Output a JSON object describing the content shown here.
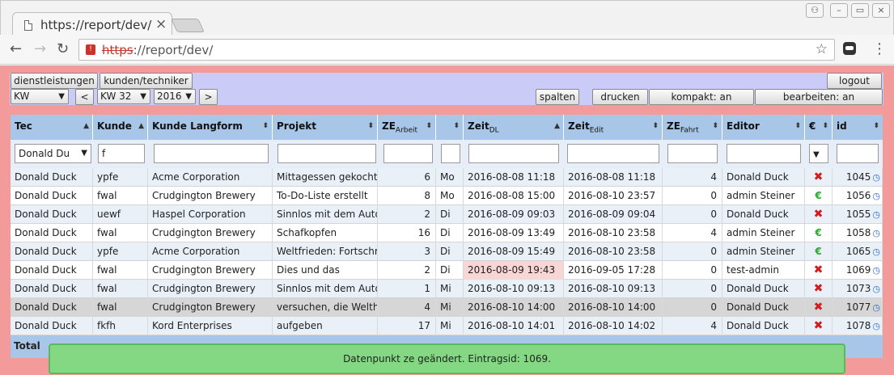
{
  "browser": {
    "tab_title": "https://report/dev/",
    "url_scheme": "https",
    "url_rest": "://report/dev/"
  },
  "controls": {
    "dienstleistungen": "dienstleistungen",
    "kunden_techniker": "kunden/techniker",
    "logout": "logout",
    "period_select": "KW",
    "prev": "<",
    "week_select": "KW 32",
    "year_select": "2016",
    "next": ">",
    "spalten": "spalten",
    "drucken": "drucken",
    "kompakt": "kompakt: an",
    "bearbeiten": "bearbeiten: an"
  },
  "columns": {
    "tec": "Tec",
    "kunde": "Kunde",
    "kunde_langform": "Kunde Langform",
    "projekt": "Projekt",
    "ze": "ZE",
    "ze_sub": "Arbeit",
    "zeit": "Zeit",
    "zeit_sub": "DL",
    "zeit_edit": "Zeit",
    "zeit_edit_sub": "Edit",
    "ze_fahrt": "ZE",
    "ze_fahrt_sub": "Fahrt",
    "editor": "Editor",
    "euro": "€",
    "id": "id"
  },
  "filters": {
    "tec": "Donald Du",
    "kunde": "f"
  },
  "rows": [
    {
      "tec": "Donald Duck",
      "kunde": "ypfe",
      "langform": "Acme Corporation",
      "projekt": "Mittagessen gekocht",
      "ze": "6",
      "tag": "Mo",
      "zeit": "2016-08-08 11:18",
      "edit": "2016-08-08 11:18",
      "fahrt": "4",
      "editor": "Donald Duck",
      "status": "✖",
      "id": "1045"
    },
    {
      "tec": "Donald Duck",
      "kunde": "fwal",
      "langform": "Crudgington Brewery",
      "projekt": "To-Do-Liste erstellt",
      "ze": "8",
      "tag": "Mo",
      "zeit": "2016-08-08 15:00",
      "edit": "2016-08-10 23:57",
      "fahrt": "0",
      "editor": "admin Steiner",
      "status": "€",
      "id": "1056"
    },
    {
      "tec": "Donald Duck",
      "kunde": "uewf",
      "langform": "Haspel Corporation",
      "projekt": "Sinnlos mit dem Auto g",
      "ze": "2",
      "tag": "Di",
      "zeit": "2016-08-09 09:03",
      "edit": "2016-08-09 09:04",
      "fahrt": "0",
      "editor": "Donald Duck",
      "status": "✖",
      "id": "1055"
    },
    {
      "tec": "Donald Duck",
      "kunde": "fwal",
      "langform": "Crudgington Brewery",
      "projekt": "Schafkopfen",
      "ze": "16",
      "tag": "Di",
      "zeit": "2016-08-09 13:49",
      "edit": "2016-08-10 23:58",
      "fahrt": "4",
      "editor": "admin Steiner",
      "status": "€",
      "id": "1058"
    },
    {
      "tec": "Donald Duck",
      "kunde": "ypfe",
      "langform": "Acme Corporation",
      "projekt": "Weltfrieden: Fortschritt",
      "ze": "3",
      "tag": "Di",
      "zeit": "2016-08-09 15:49",
      "edit": "2016-08-10 23:58",
      "fahrt": "0",
      "editor": "admin Steiner",
      "status": "€",
      "id": "1065"
    },
    {
      "tec": "Donald Duck",
      "kunde": "fwal",
      "langform": "Crudgington Brewery",
      "projekt": "Dies und das",
      "ze": "2",
      "tag": "Di",
      "zeit": "2016-08-09 19:43",
      "edit": "2016-09-05 17:28",
      "fahrt": "0",
      "editor": "test-admin",
      "status": "✖",
      "id": "1069"
    },
    {
      "tec": "Donald Duck",
      "kunde": "fwal",
      "langform": "Crudgington Brewery",
      "projekt": "Sinnlos mit dem Auto g",
      "ze": "1",
      "tag": "Mi",
      "zeit": "2016-08-10 09:13",
      "edit": "2016-08-10 09:13",
      "fahrt": "0",
      "editor": "Donald Duck",
      "status": "✖",
      "id": "1073"
    },
    {
      "tec": "Donald Duck",
      "kunde": "fwal",
      "langform": "Crudgington Brewery",
      "projekt": "versuchen, die Welther",
      "ze": "4",
      "tag": "Mi",
      "zeit": "2016-08-10 14:00",
      "edit": "2016-08-10 14:00",
      "fahrt": "0",
      "editor": "Donald Duck",
      "status": "✖",
      "id": "1077"
    },
    {
      "tec": "Donald Duck",
      "kunde": "fkfh",
      "langform": "Kord Enterprises",
      "projekt": "aufgeben",
      "ze": "17",
      "tag": "Mi",
      "zeit": "2016-08-10 14:01",
      "edit": "2016-08-10 14:02",
      "fahrt": "4",
      "editor": "Donald Duck",
      "status": "✖",
      "id": "1078"
    }
  ],
  "total_label": "Total",
  "toast": "Datenpunkt ze geändert. Eintragsid: 1069."
}
